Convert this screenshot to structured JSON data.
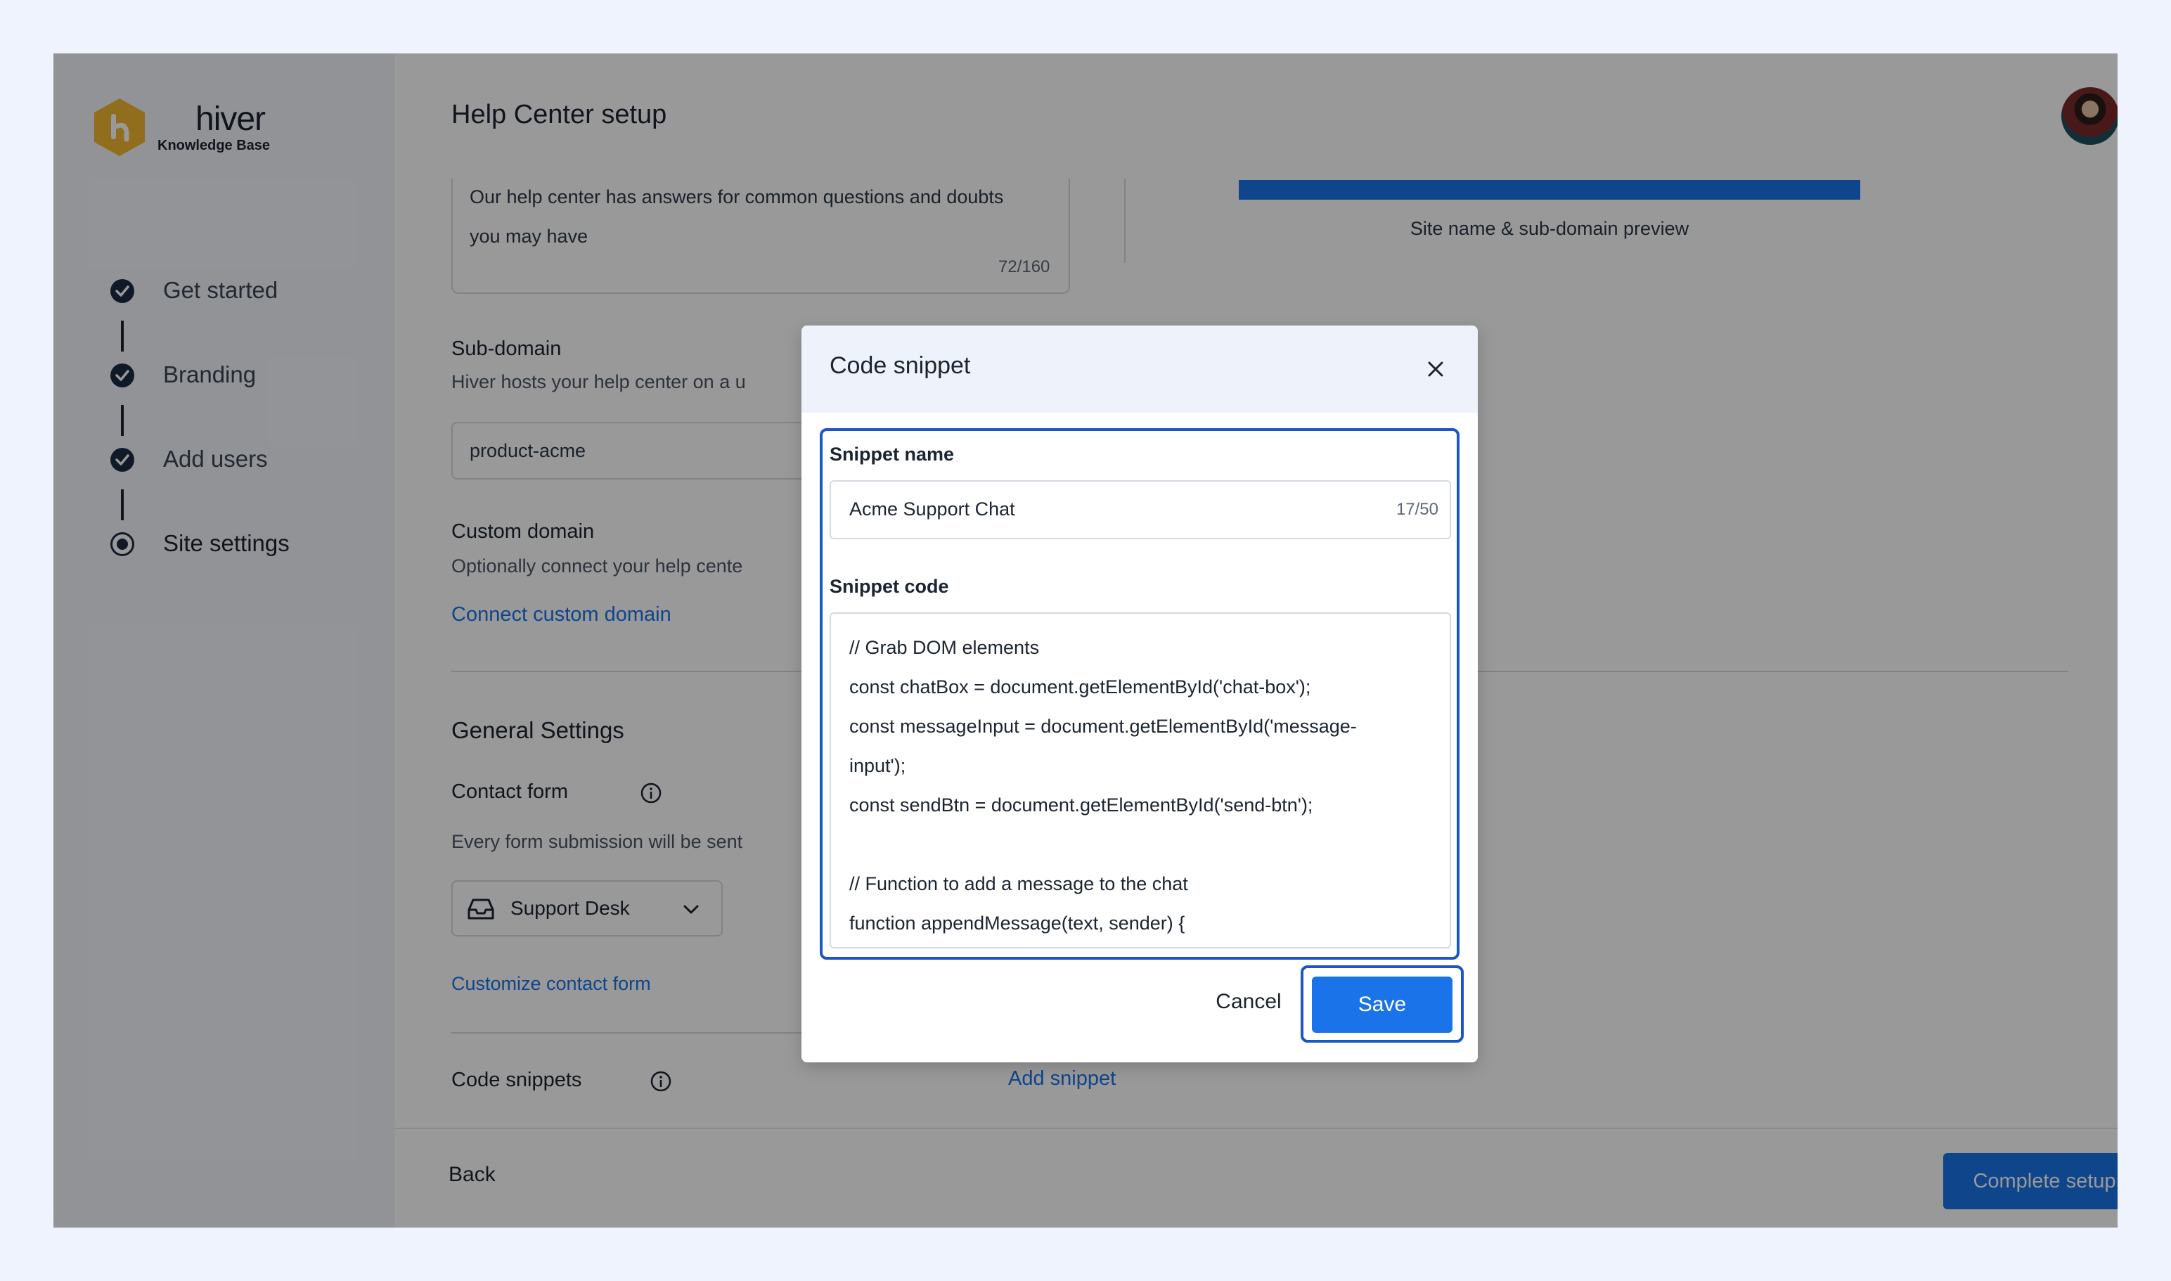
{
  "brand": {
    "name": "hiver",
    "subtitle": "Knowledge Base",
    "accent": "#1a73e8",
    "logo_color": "#f2b632"
  },
  "steps": [
    {
      "label": "Get started",
      "state": "done"
    },
    {
      "label": "Branding",
      "state": "done"
    },
    {
      "label": "Add users",
      "state": "done"
    },
    {
      "label": "Site settings",
      "state": "current"
    }
  ],
  "page": {
    "title": "Help Center setup"
  },
  "description": {
    "text": "Our help center has answers for common questions and doubts you may have",
    "count": "72/160"
  },
  "preview": {
    "caption": "Site name & sub-domain preview"
  },
  "subdomain": {
    "label": "Sub-domain",
    "help": "Hiver hosts your help center on a u",
    "value": "product-acme"
  },
  "custom_domain": {
    "label": "Custom domain",
    "help": "Optionally connect your help cente",
    "link": "Connect custom domain"
  },
  "general": {
    "heading": "General Settings",
    "contact_form_label": "Contact form",
    "contact_form_help": "Every form submission will be sent",
    "inbox_value": "Support Desk",
    "customize_link": "Customize contact form",
    "code_snippets_label": "Code snippets",
    "add_snippet_link": "Add snippet"
  },
  "footer": {
    "back": "Back",
    "complete": "Complete setup"
  },
  "modal": {
    "title": "Code snippet",
    "name_label": "Snippet name",
    "name_value": "Acme Support Chat",
    "name_count": "17/50",
    "code_label": "Snippet code",
    "code_lines": [
      "// Grab DOM elements",
      "const chatBox = document.getElementById('chat-box');",
      "const messageInput = document.getElementById('message-",
      "input');",
      "const sendBtn = document.getElementById('send-btn');",
      "",
      "// Function to add a message to the chat",
      "function appendMessage(text, sender) {"
    ],
    "cancel": "Cancel",
    "save": "Save"
  },
  "icons": {
    "logo": "hiver-hexagon-logo",
    "check": "check-circle-icon",
    "current": "radio-current-icon",
    "info": "info-icon",
    "inbox": "inbox-icon",
    "chevron": "chevron-down-icon",
    "close": "close-icon"
  }
}
